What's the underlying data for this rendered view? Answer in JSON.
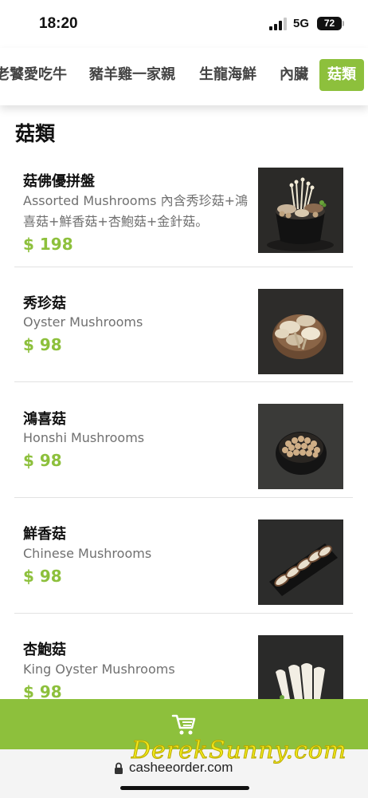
{
  "status_bar": {
    "time": "18:20",
    "network": "5G",
    "battery": "72"
  },
  "category_nav": {
    "tabs": [
      {
        "label": "老饕愛吃牛",
        "active": false
      },
      {
        "label": "豬羊雞一家親",
        "active": false
      },
      {
        "label": "生龍海鮮",
        "active": false
      },
      {
        "label": "內臟",
        "active": false
      },
      {
        "label": "菇類",
        "active": true
      }
    ]
  },
  "section": {
    "title": "菇類",
    "items": [
      {
        "name": "菇佛優拼盤",
        "desc": "Assorted Mushrooms 內含秀珍菇+鴻喜菇+鮮香菇+杏鮑菇+金針菇。",
        "price": "$ 198",
        "photo": "assorted-mushroom-platter-photo"
      },
      {
        "name": "秀珍菇",
        "desc": "Oyster Mushrooms",
        "price": "$ 98",
        "photo": "oyster-mushroom-photo"
      },
      {
        "name": "鴻喜菇",
        "desc": "Honshi Mushrooms",
        "price": "$ 98",
        "photo": "honshi-mushroom-photo"
      },
      {
        "name": "鮮香菇",
        "desc": "Chinese Mushrooms",
        "price": "$ 98",
        "photo": "shiitake-mushroom-photo"
      },
      {
        "name": "杏鮑菇",
        "desc": "King Oyster Mushrooms",
        "price": "$ 98",
        "photo": "king-oyster-mushroom-photo"
      }
    ]
  },
  "cart": {
    "icon": "shopping-cart-icon"
  },
  "address_bar": {
    "url": "casheeorder.com",
    "watermark": "DerekSunny.com"
  },
  "colors": {
    "accent": "#8dc03c",
    "watermark": "#f2ea1c"
  }
}
